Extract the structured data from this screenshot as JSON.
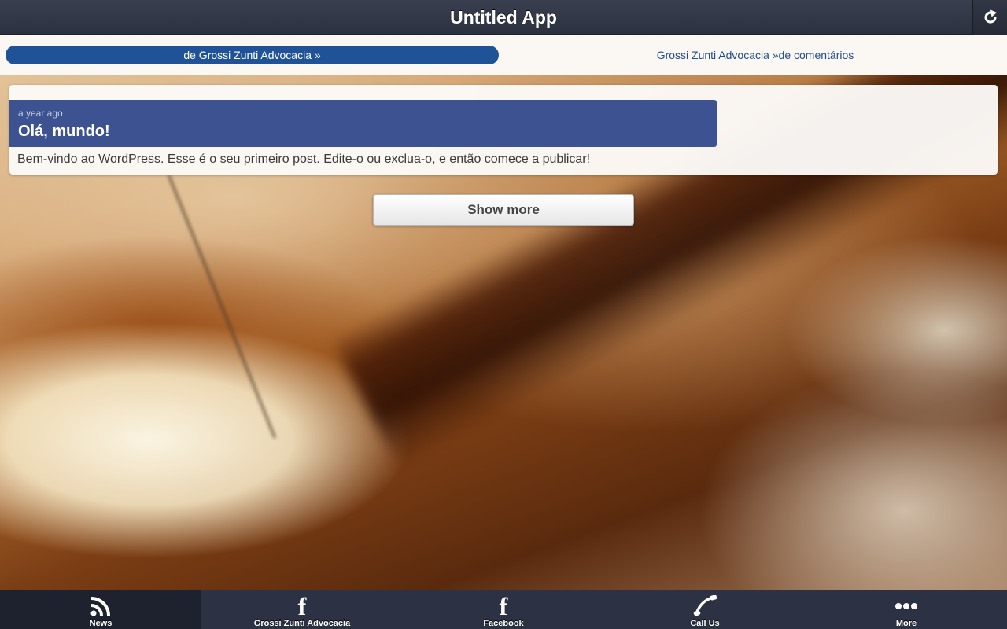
{
  "header": {
    "title": "Untitled App",
    "refresh_icon": "refresh-icon"
  },
  "subnav": {
    "active_label": "de Grossi Zunti Advocacia »",
    "other_label": "Grossi Zunti Advocacia »de comentários"
  },
  "post": {
    "date": "a year ago",
    "title": "Olá, mundo!",
    "excerpt": "Bem-vindo ao WordPress. Esse é o seu primeiro post. Edite-o ou exclua-o, e então comece a publicar!"
  },
  "show_more_label": "Show more",
  "tabs": [
    {
      "label": "News",
      "icon": "rss-icon",
      "active": true
    },
    {
      "label": "Grossi Zunti Advocacia",
      "icon": "facebook-icon",
      "active": false
    },
    {
      "label": "Facebook",
      "icon": "facebook-icon",
      "active": false
    },
    {
      "label": "Call Us",
      "icon": "phone-icon",
      "active": false
    },
    {
      "label": "More",
      "icon": "more-icon",
      "active": false
    }
  ],
  "colors": {
    "header_bg": "#2c3140",
    "accent_blue": "#1f5296",
    "card_head": "#3d5291",
    "tabbar_bg": "#2c3244"
  }
}
